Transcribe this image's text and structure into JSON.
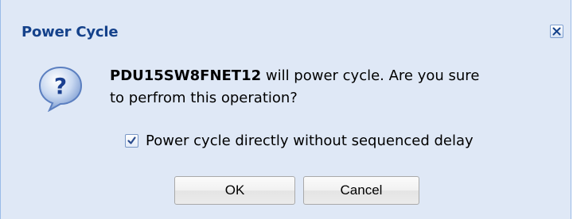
{
  "dialog": {
    "title": "Power Cycle",
    "close_icon": "close-icon",
    "question_icon": "question-icon",
    "message": {
      "device": "PDU15SW8FNET12",
      "text_line1": " will power cycle. Are you sure",
      "text_line2": "to perfrom this operation?"
    },
    "checkbox": {
      "label": "Power cycle directly without sequenced delay",
      "checked": true
    },
    "buttons": {
      "ok": "OK",
      "cancel": "Cancel"
    }
  },
  "colors": {
    "background": "#dfe8f6",
    "title": "#15428b",
    "border": "#99bbe8"
  }
}
